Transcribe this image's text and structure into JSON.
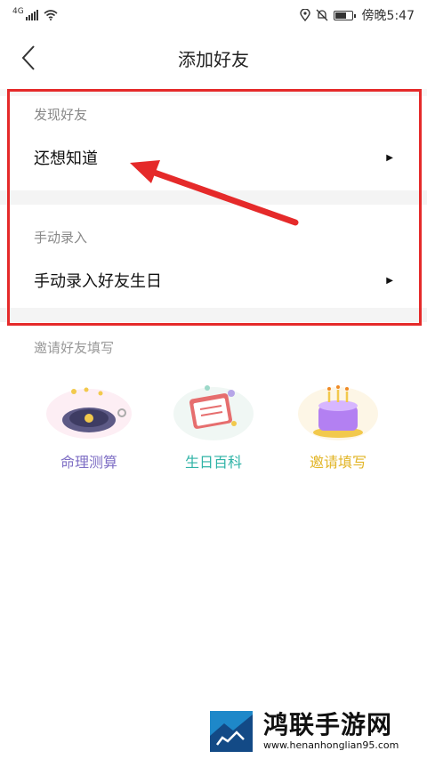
{
  "status_bar": {
    "network": "4G",
    "time": "傍晚5:47"
  },
  "nav": {
    "title": "添加好友",
    "back_icon": "chevron-left-icon"
  },
  "discover": {
    "header": "发现好友",
    "row_label": "还想知道"
  },
  "manual": {
    "header": "手动录入",
    "row_label": "手动录入好友生日"
  },
  "invite": {
    "title": "邀请好友填写",
    "items": [
      {
        "label": "命理测算",
        "color": "#7f6fc5",
        "icon": "fortune-compass-icon"
      },
      {
        "label": "生日百科",
        "color": "#2fb3a6",
        "icon": "calendar-book-icon"
      },
      {
        "label": "邀请填写",
        "color": "#e2b527",
        "icon": "birthday-cake-icon"
      }
    ]
  },
  "annotation": {
    "frame_color": "#e52a2a"
  },
  "watermark": {
    "name": "鸿联手游网",
    "url": "www.henanhonglian95.com"
  }
}
